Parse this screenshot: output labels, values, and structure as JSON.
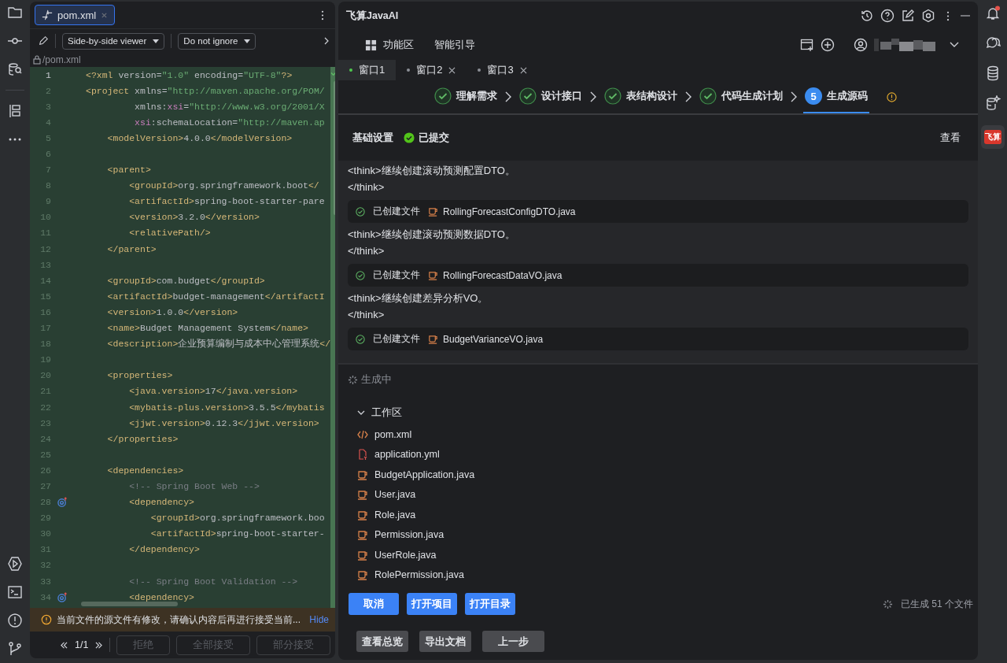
{
  "editor": {
    "tab": {
      "label": "pom.xml",
      "selected": true
    },
    "toolbar": {
      "viewer": "Side-by-side viewer",
      "ignore": "Do not ignore"
    },
    "path": "/pom.xml",
    "lines": [
      {
        "number": "1",
        "current": true,
        "marker": false,
        "tokens": [
          {
            "kind": "tag",
            "text": "<?xml"
          },
          {
            "kind": "attr",
            "text": " version"
          },
          {
            "kind": "text",
            "text": "="
          },
          {
            "kind": "str",
            "text": "\"1.0\""
          },
          {
            "kind": "attr",
            "text": " encoding"
          },
          {
            "kind": "text",
            "text": "="
          },
          {
            "kind": "str",
            "text": "\"UTF-8\""
          },
          {
            "kind": "tag",
            "text": "?>"
          }
        ]
      },
      {
        "number": "2",
        "current": false,
        "marker": false,
        "tokens": [
          {
            "kind": "tag",
            "text": "<project"
          },
          {
            "kind": "attr",
            "text": " xmlns"
          },
          {
            "kind": "text",
            "text": "="
          },
          {
            "kind": "str",
            "text": "\"http://maven.apache.org/POM/"
          }
        ]
      },
      {
        "number": "3",
        "current": false,
        "marker": false,
        "tokens": [
          {
            "kind": "attr",
            "text": "         xmlns:"
          },
          {
            "kind": "ns",
            "text": "xsi"
          },
          {
            "kind": "text",
            "text": "="
          },
          {
            "kind": "str",
            "text": "\"http://www.w3.org/2001/X"
          }
        ]
      },
      {
        "number": "4",
        "current": false,
        "marker": false,
        "tokens": [
          {
            "kind": "ns",
            "text": "         xsi"
          },
          {
            "kind": "attr",
            "text": ":schemaLocation"
          },
          {
            "kind": "text",
            "text": "="
          },
          {
            "kind": "str",
            "text": "\"http://maven.ap"
          }
        ]
      },
      {
        "number": "5",
        "current": false,
        "marker": false,
        "tokens": [
          {
            "kind": "tag",
            "text": "    <modelVersion>"
          },
          {
            "kind": "text",
            "text": "4.0.0"
          },
          {
            "kind": "tag",
            "text": "</modelVersion>"
          }
        ]
      },
      {
        "number": "6",
        "current": false,
        "marker": false
      },
      {
        "number": "7",
        "current": false,
        "marker": false,
        "tokens": [
          {
            "kind": "tag",
            "text": "    <parent>"
          }
        ]
      },
      {
        "number": "8",
        "current": false,
        "marker": false,
        "tokens": [
          {
            "kind": "tag",
            "text": "        <groupId>"
          },
          {
            "kind": "text",
            "text": "org.springframework.boot"
          },
          {
            "kind": "tag",
            "text": "</"
          }
        ]
      },
      {
        "number": "9",
        "current": false,
        "marker": false,
        "tokens": [
          {
            "kind": "tag",
            "text": "        <artifactId>"
          },
          {
            "kind": "text",
            "text": "spring-boot-starter-pare"
          }
        ]
      },
      {
        "number": "10",
        "current": false,
        "marker": false,
        "tokens": [
          {
            "kind": "tag",
            "text": "        <version>"
          },
          {
            "kind": "text",
            "text": "3.2.0"
          },
          {
            "kind": "tag",
            "text": "</version>"
          }
        ]
      },
      {
        "number": "11",
        "current": false,
        "marker": false,
        "tokens": [
          {
            "kind": "tag",
            "text": "        <relativePath/>"
          }
        ]
      },
      {
        "number": "12",
        "current": false,
        "marker": false,
        "tokens": [
          {
            "kind": "tag",
            "text": "    </parent>"
          }
        ]
      },
      {
        "number": "13",
        "current": false,
        "marker": false
      },
      {
        "number": "14",
        "current": false,
        "marker": false,
        "tokens": [
          {
            "kind": "tag",
            "text": "    <groupId>"
          },
          {
            "kind": "text",
            "text": "com.budget"
          },
          {
            "kind": "tag",
            "text": "</groupId>"
          }
        ]
      },
      {
        "number": "15",
        "current": false,
        "marker": false,
        "tokens": [
          {
            "kind": "tag",
            "text": "    <artifactId>"
          },
          {
            "kind": "text",
            "text": "budget-management"
          },
          {
            "kind": "tag",
            "text": "</artifactI"
          }
        ]
      },
      {
        "number": "16",
        "current": false,
        "marker": false,
        "tokens": [
          {
            "kind": "tag",
            "text": "    <version>"
          },
          {
            "kind": "text",
            "text": "1.0.0"
          },
          {
            "kind": "tag",
            "text": "</version>"
          }
        ]
      },
      {
        "number": "17",
        "current": false,
        "marker": false,
        "tokens": [
          {
            "kind": "tag",
            "text": "    <name>"
          },
          {
            "kind": "text",
            "text": "Budget Management System"
          },
          {
            "kind": "tag",
            "text": "</name>"
          }
        ]
      },
      {
        "number": "18",
        "current": false,
        "marker": false,
        "tokens": [
          {
            "kind": "tag",
            "text": "    <description>"
          },
          {
            "kind": "text",
            "text": "企业预算编制与成本中心管理系统"
          },
          {
            "kind": "tag",
            "text": "</"
          }
        ]
      },
      {
        "number": "19",
        "current": false,
        "marker": false
      },
      {
        "number": "20",
        "current": false,
        "marker": false,
        "tokens": [
          {
            "kind": "tag",
            "text": "    <properties>"
          }
        ]
      },
      {
        "number": "21",
        "current": false,
        "marker": false,
        "tokens": [
          {
            "kind": "tag",
            "text": "        <java.version>"
          },
          {
            "kind": "text",
            "text": "17"
          },
          {
            "kind": "tag",
            "text": "</java.version>"
          }
        ]
      },
      {
        "number": "22",
        "current": false,
        "marker": false,
        "tokens": [
          {
            "kind": "tag",
            "text": "        <mybatis-plus.version>"
          },
          {
            "kind": "text",
            "text": "3.5.5"
          },
          {
            "kind": "tag",
            "text": "</mybatis"
          }
        ]
      },
      {
        "number": "23",
        "current": false,
        "marker": false,
        "tokens": [
          {
            "kind": "tag",
            "text": "        <jjwt.version>"
          },
          {
            "kind": "text",
            "text": "0.12.3"
          },
          {
            "kind": "tag",
            "text": "</jjwt.version>"
          }
        ]
      },
      {
        "number": "24",
        "current": false,
        "marker": false,
        "tokens": [
          {
            "kind": "tag",
            "text": "    </properties>"
          }
        ]
      },
      {
        "number": "25",
        "current": false,
        "marker": false
      },
      {
        "number": "26",
        "current": false,
        "marker": false,
        "tokens": [
          {
            "kind": "tag",
            "text": "    <dependencies>"
          }
        ]
      },
      {
        "number": "27",
        "current": false,
        "marker": false,
        "tokens": [
          {
            "kind": "comment",
            "text": "        <!-- Spring Boot Web -->"
          }
        ]
      },
      {
        "number": "28",
        "current": false,
        "marker": true,
        "tokens": [
          {
            "kind": "tag",
            "text": "        <dependency>"
          }
        ]
      },
      {
        "number": "29",
        "current": false,
        "marker": false,
        "tokens": [
          {
            "kind": "tag",
            "text": "            <groupId>"
          },
          {
            "kind": "text",
            "text": "org.springframework.boo"
          }
        ]
      },
      {
        "number": "30",
        "current": false,
        "marker": false,
        "tokens": [
          {
            "kind": "tag",
            "text": "            <artifactId>"
          },
          {
            "kind": "text",
            "text": "spring-boot-starter-"
          }
        ]
      },
      {
        "number": "31",
        "current": false,
        "marker": false,
        "tokens": [
          {
            "kind": "tag",
            "text": "        </dependency>"
          }
        ]
      },
      {
        "number": "32",
        "current": false,
        "marker": false
      },
      {
        "number": "33",
        "current": false,
        "marker": false,
        "tokens": [
          {
            "kind": "comment",
            "text": "        <!-- Spring Boot Validation -->"
          }
        ]
      },
      {
        "number": "34",
        "current": false,
        "marker": true,
        "tokens": [
          {
            "kind": "tag",
            "text": "        <dependency>"
          }
        ]
      }
    ],
    "banner": {
      "text": "当前文件的源文件有修改，请确认内容后再进行接受当前...",
      "link": "Hide"
    },
    "footer": {
      "counter": "1/1",
      "buttons": [
        {
          "label": "拒绝",
          "disabled": true
        },
        {
          "label": "全部接受",
          "disabled": true
        },
        {
          "label": "部分接受",
          "disabled": true
        }
      ]
    }
  },
  "assistant": {
    "title": "飞算JavaAI",
    "nav": [
      "功能区",
      "智能引导"
    ],
    "tabs": [
      {
        "label": "窗口1",
        "selected": true,
        "closable": false
      },
      {
        "label": "窗口2",
        "selected": false,
        "closable": true
      },
      {
        "label": "窗口3",
        "selected": false,
        "closable": true
      }
    ],
    "steps": [
      {
        "label": "理解需求",
        "done": true,
        "selected": false
      },
      {
        "label": "设计接口",
        "done": true,
        "selected": false
      },
      {
        "label": "表结构设计",
        "done": true,
        "selected": false
      },
      {
        "label": "代码生成计划",
        "done": true,
        "selected": false
      },
      {
        "label": "生成源码",
        "number": "5",
        "done": false,
        "selected": true
      }
    ],
    "settings": {
      "label": "基础设置",
      "status": "已提交",
      "action": "查看"
    },
    "log": [
      {
        "thought": "<think>继续创建滚动预测配置DTO。",
        "closing": "</think>",
        "status": "已创建文件",
        "file": "RollingForecastConfigDTO.java"
      },
      {
        "thought": "<think>继续创建滚动预测数据DTO。",
        "closing": "</think>",
        "status": "已创建文件",
        "file": "RollingForecastDataVO.java"
      },
      {
        "thought": "<think>继续创建差异分析VO。",
        "closing": "</think>",
        "status": "已创建文件",
        "file": "BudgetVarianceVO.java"
      }
    ],
    "progress": "生成中",
    "workspace": {
      "label": "工作区",
      "expanded": true,
      "files": [
        {
          "name": "pom.xml",
          "kind": "xml"
        },
        {
          "name": "application.yml",
          "kind": "yaml"
        },
        {
          "name": "BudgetApplication.java",
          "kind": "java"
        },
        {
          "name": "User.java",
          "kind": "java"
        },
        {
          "name": "Role.java",
          "kind": "java"
        },
        {
          "name": "Permission.java",
          "kind": "java"
        },
        {
          "name": "UserRole.java",
          "kind": "java"
        },
        {
          "name": "RolePermission.java",
          "kind": "java"
        }
      ]
    },
    "actions": [
      "取消",
      "打开项目",
      "打开目录"
    ],
    "generated": "已生成 51 个文件",
    "secondary": [
      "查看总览",
      "导出文档",
      "上一步"
    ]
  },
  "rail": {
    "logo": "飞算",
    "notification": true
  }
}
